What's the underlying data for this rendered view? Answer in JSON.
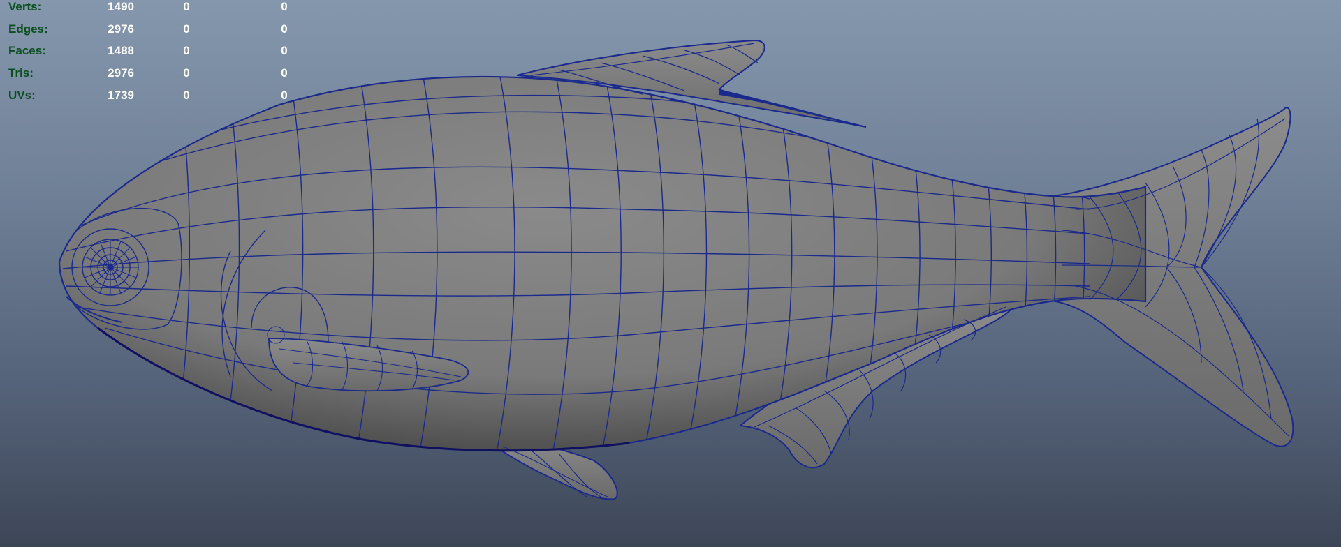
{
  "viewport": {
    "name": "3D modeling viewport",
    "background_top": "#8597ad",
    "background_bottom": "#3d4657",
    "wireframe_color": "#1a2a8c",
    "shaded_color": "#7d7d7d"
  },
  "hud": {
    "label_color": "#0b4f1f",
    "value_color": "#ffffff",
    "rows": [
      {
        "label": "Verts:",
        "total": "1490",
        "selected": "0",
        "selected_component": "0"
      },
      {
        "label": "Edges:",
        "total": "2976",
        "selected": "0",
        "selected_component": "0"
      },
      {
        "label": "Faces:",
        "total": "1488",
        "selected": "0",
        "selected_component": "0"
      },
      {
        "label": "Tris:",
        "total": "2976",
        "selected": "0",
        "selected_component": "0"
      },
      {
        "label": "UVs:",
        "total": "1739",
        "selected": "0",
        "selected_component": "0"
      }
    ]
  },
  "model": {
    "icon": "fish-mesh"
  }
}
